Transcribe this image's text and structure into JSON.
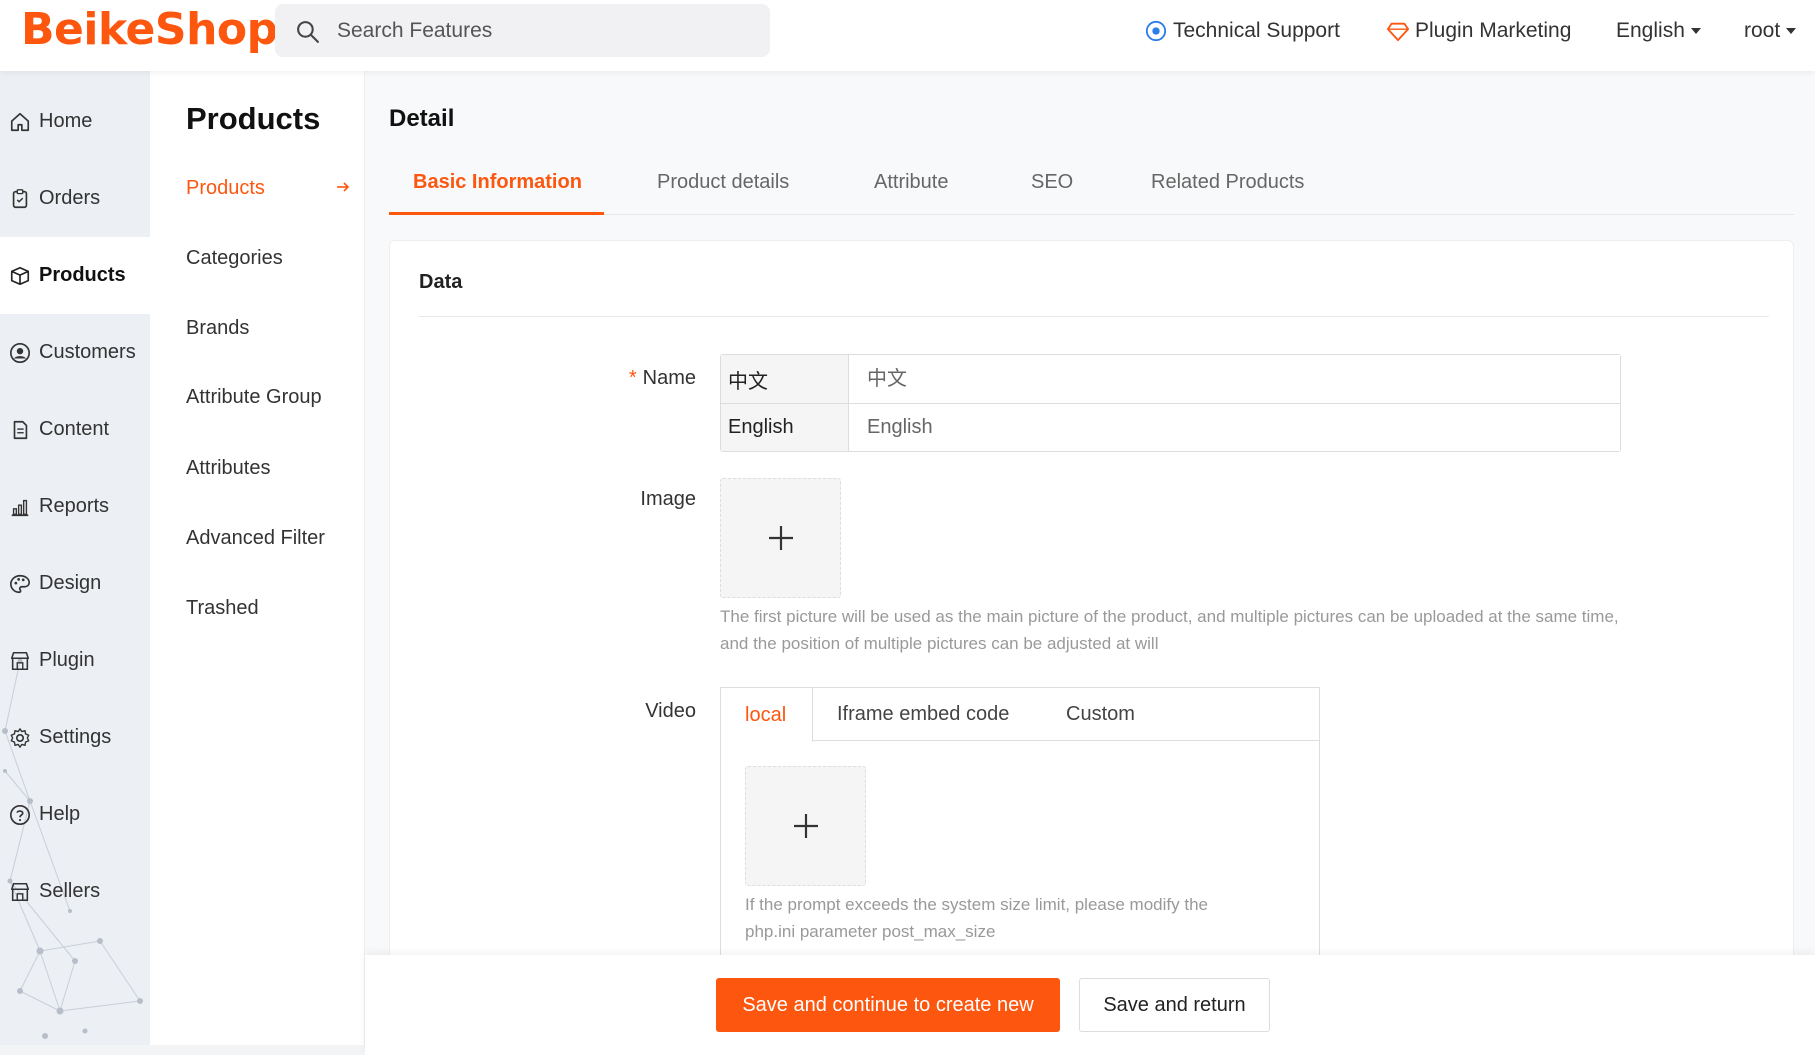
{
  "header": {
    "logo": "BeikeShop",
    "search_placeholder": "Search Features",
    "tech_support": "Technical Support",
    "plugin_marketing": "Plugin Marketing",
    "language": "English",
    "user": "root"
  },
  "sidebar": {
    "items": [
      {
        "label": "Home",
        "icon": "home-icon"
      },
      {
        "label": "Orders",
        "icon": "clipboard-icon"
      },
      {
        "label": "Products",
        "icon": "box-icon"
      },
      {
        "label": "Customers",
        "icon": "user-circle-icon"
      },
      {
        "label": "Content",
        "icon": "document-icon"
      },
      {
        "label": "Reports",
        "icon": "bar-chart-icon"
      },
      {
        "label": "Design",
        "icon": "palette-icon"
      },
      {
        "label": "Plugin",
        "icon": "store-icon"
      },
      {
        "label": "Settings",
        "icon": "gear-icon"
      },
      {
        "label": "Help",
        "icon": "question-icon"
      },
      {
        "label": "Sellers",
        "icon": "store-icon"
      }
    ],
    "active": "Products"
  },
  "subsidebar": {
    "title": "Products",
    "items": [
      "Products",
      "Categories",
      "Brands",
      "Attribute Group",
      "Attributes",
      "Advanced Filter",
      "Trashed"
    ]
  },
  "main": {
    "title": "Detail",
    "tabs": [
      "Basic Information",
      "Product details",
      "Attribute",
      "SEO",
      "Related Products"
    ],
    "card_title": "Data",
    "name_label": "Name",
    "name_rows": [
      {
        "lang": "中文",
        "placeholder": "中文"
      },
      {
        "lang": "English",
        "placeholder": "English"
      }
    ],
    "image_label": "Image",
    "image_hint_line1": "The first picture will be used as the main picture of the product, and multiple pictures can be uploaded at the same time,",
    "image_hint_line2": "and the position of multiple pictures can be adjusted at will",
    "video_label": "Video",
    "video_tabs": [
      "local",
      "Iframe embed code",
      "Custom"
    ],
    "video_hint_line1": "If the prompt exceeds the system size limit, please modify the",
    "video_hint_line2": "php.ini parameter post_max_size"
  },
  "footer": {
    "primary": "Save and continue to create new",
    "secondary": "Save and return"
  },
  "colors": {
    "accent": "#fd560f",
    "sidebar_bg": "#eceff4"
  }
}
